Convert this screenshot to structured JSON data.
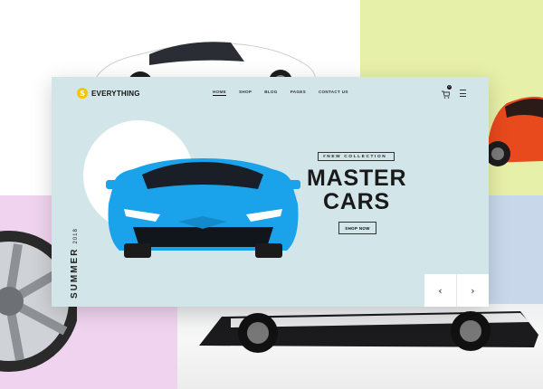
{
  "brand": {
    "name": "EVERYTHING",
    "mark": "S"
  },
  "nav": {
    "items": [
      "HOME",
      "SHOP",
      "BLOG",
      "PAGES",
      "CONTACT US"
    ],
    "active": "HOME"
  },
  "cart": {
    "count": "0"
  },
  "hero": {
    "tag": "#NEW COLLECTION",
    "title_line1": "MASTER",
    "title_line2": "CARS",
    "cta": "SHOP NOW",
    "season_word": "SUMMER",
    "season_year": "2018"
  },
  "slider": {
    "prev_icon": "‹",
    "next_icon": "›"
  },
  "colors": {
    "card_bg": "#d2e6e9",
    "car_blue": "#1aa3ea",
    "brand_yellow": "#f6c400",
    "orange_car": "#e8491d"
  },
  "icons": [
    "cart-icon",
    "menu-icon",
    "chevron-left-icon",
    "chevron-right-icon"
  ]
}
